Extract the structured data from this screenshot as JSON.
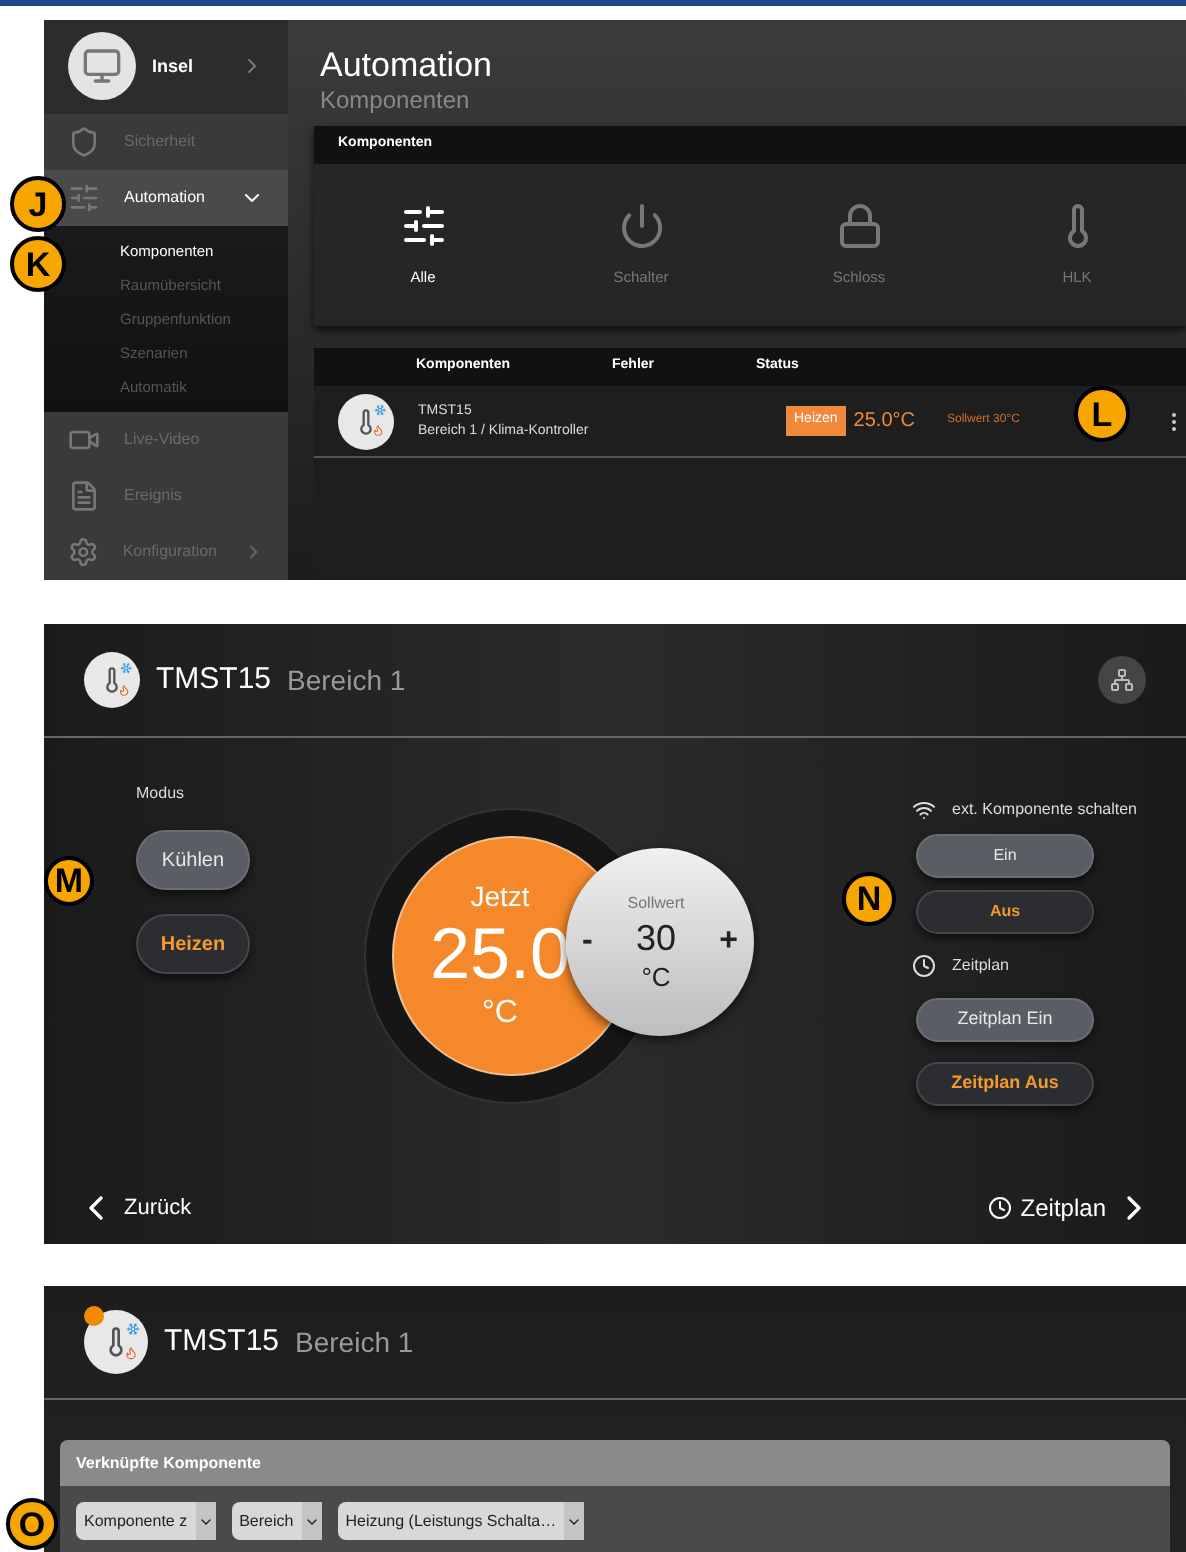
{
  "screen_1": {
    "sidebar": {
      "profile": {
        "name": "Insel"
      },
      "items": [
        {
          "label": "Sicherheit",
          "selected": false,
          "arrow": false
        },
        {
          "label": "Automation",
          "selected": true,
          "arrow": false,
          "expanded": true,
          "callout": "J",
          "children": [
            {
              "label": "Komponenten",
              "selected": true,
              "callout": "K"
            },
            {
              "label": "Raumübersicht",
              "selected": false
            },
            {
              "label": "Gruppenfunktion",
              "selected": false
            },
            {
              "label": "Szenarien",
              "selected": false
            },
            {
              "label": "Automatik",
              "selected": false
            }
          ]
        },
        {
          "label": "Live-Video",
          "selected": false,
          "arrow": false
        },
        {
          "label": "Ereignis",
          "selected": false,
          "arrow": false
        },
        {
          "label": "Konfiguration",
          "selected": false,
          "arrow": true
        }
      ]
    },
    "title": "Automation",
    "subtitle": "Komponenten",
    "category_card": {
      "title": "Komponenten",
      "tiles": [
        {
          "label": "Alle",
          "selected": true
        },
        {
          "label": "Schalter",
          "selected": false
        },
        {
          "label": "Schloss",
          "selected": false
        },
        {
          "label": "HLK",
          "selected": false
        }
      ]
    },
    "table": {
      "columns": [
        "Komponenten",
        "Fehler",
        "Status"
      ],
      "rows": [
        {
          "name": "TMST15",
          "detail": "Bereich 1 / Klima-Kontroller",
          "status": "Heizen",
          "temperature": "25.0°C",
          "setpoint": "Sollwert 30°C",
          "callout": "L"
        }
      ]
    }
  },
  "screen_2": {
    "title": "TMST15",
    "subtitle": "Bereich 1",
    "mode": {
      "label": "Modus",
      "callout": "M",
      "buttons": [
        {
          "label": "Kühlen",
          "selected": false
        },
        {
          "label": "Heizen",
          "selected": true
        }
      ]
    },
    "current": {
      "label": "Jetzt",
      "value": "25.0",
      "unit": "°C"
    },
    "setpoint": {
      "label": "Sollwert",
      "value": "30",
      "unit": "°C",
      "minus": "-",
      "plus": "+"
    },
    "switch": {
      "label": "ext. Komponente schalten",
      "callout": "N",
      "buttons": [
        {
          "label": "Ein",
          "selected": false
        },
        {
          "label": "Aus",
          "selected": true
        }
      ]
    },
    "schedule": {
      "label": "Zeitplan",
      "buttons": [
        {
          "label": "Zeitplan Ein",
          "selected": false
        },
        {
          "label": "Zeitplan Aus",
          "selected": true
        }
      ]
    },
    "back": "Zurück",
    "next": "Zeitplan"
  },
  "screen_3": {
    "title": "TMST15",
    "subtitle": "Bereich 1",
    "card": {
      "title": "Verknüpfte Komponente",
      "callout": "O",
      "dropdowns": [
        "Komponente z",
        "Bereich",
        "Heizung (Leistungs Schalta…"
      ]
    }
  }
}
